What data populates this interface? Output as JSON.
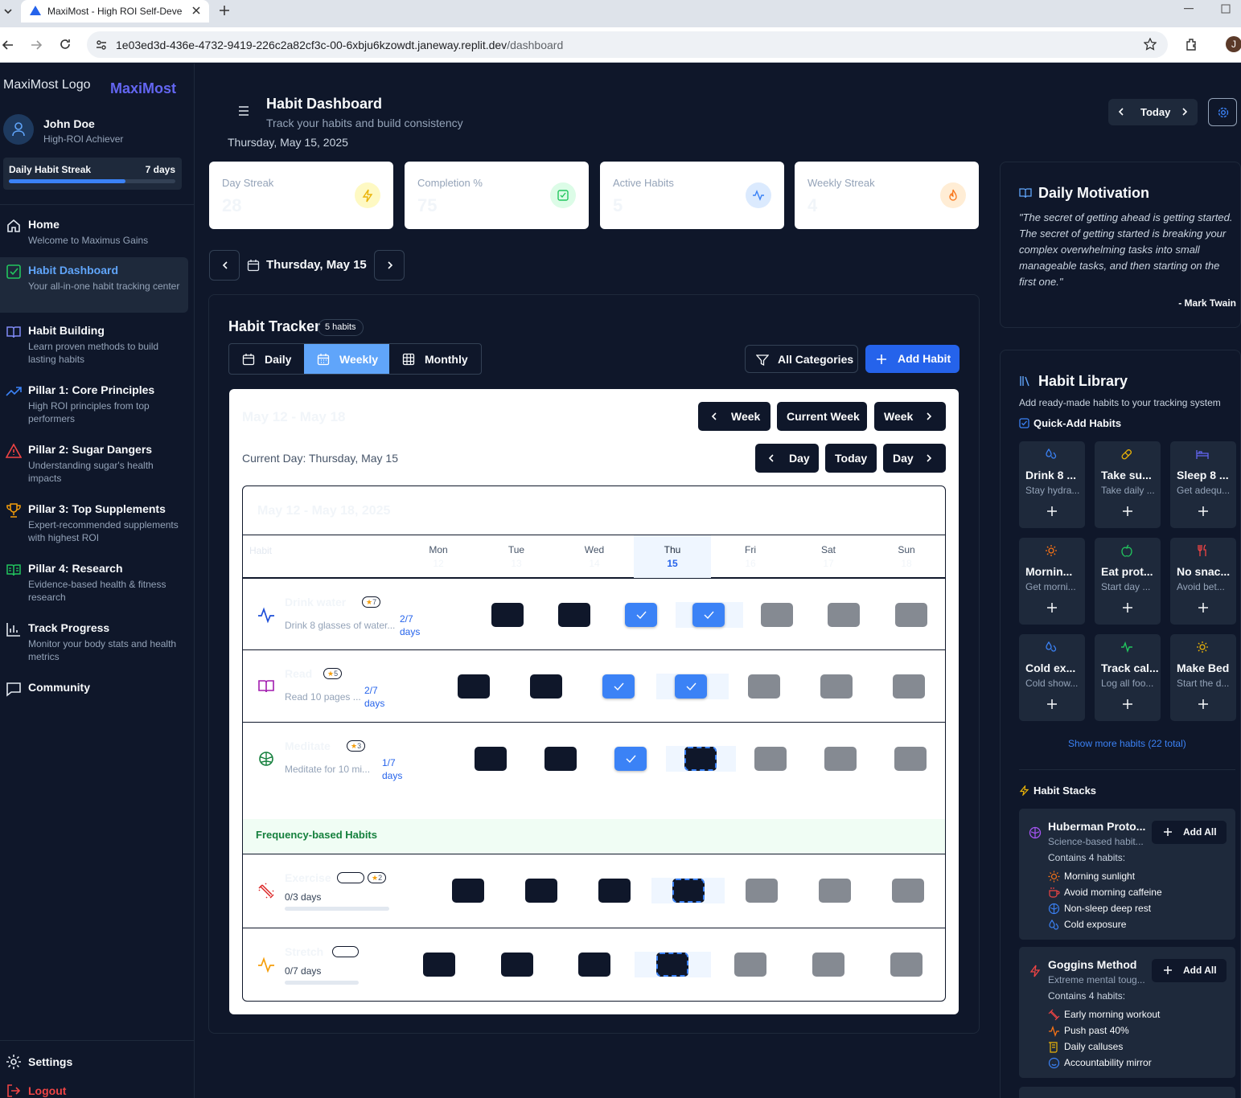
{
  "browser": {
    "tab_title": "MaxiMost - High ROI Self-Deve",
    "url_host": "1e03ed3d-436e-4732-9419-226c2a82cf3c-00-6xbju6kzowdt.janeway.replit.dev",
    "url_path": "/dashboard",
    "profile_initial": "J"
  },
  "sidebar": {
    "logo_alt": "MaxiMost Logo",
    "brand": "MaxiMost",
    "user_name": "John Doe",
    "user_role": "High-ROI Achiever",
    "streak_label": "Daily Habit Streak",
    "streak_value": "7 days",
    "streak_progress": 0.7,
    "items": [
      {
        "title": "Home",
        "desc": "Welcome to Maximus Gains"
      },
      {
        "title": "Habit Dashboard",
        "desc": "Your all-in-one habit tracking center"
      },
      {
        "title": "Habit Building",
        "desc": "Learn proven methods to build lasting habits"
      },
      {
        "title": "Pillar 1: Core Principles",
        "desc": "High ROI principles from top performers"
      },
      {
        "title": "Pillar 2: Sugar Dangers",
        "desc": "Understanding sugar's health impacts"
      },
      {
        "title": "Pillar 3: Top Supplements",
        "desc": "Expert-recommended supplements with highest ROI"
      },
      {
        "title": "Pillar 4: Research",
        "desc": "Evidence-based health & fitness research"
      },
      {
        "title": "Track Progress",
        "desc": "Monitor your body stats and health metrics"
      },
      {
        "title": "Community",
        "desc": ""
      }
    ],
    "settings": "Settings",
    "logout": "Logout"
  },
  "header": {
    "title": "Habit Dashboard",
    "subtitle": "Track your habits and build consistency",
    "date": "Thursday, May 15, 2025",
    "today_btn": "Today"
  },
  "stats": [
    {
      "label": "Day Streak",
      "value": "28",
      "color": "#eab308"
    },
    {
      "label": "Completion %",
      "value": "75",
      "color": "#22c55e"
    },
    {
      "label": "Active Habits",
      "value": "5",
      "color": "#3b82f6"
    },
    {
      "label": "Weekly Streak",
      "value": "4",
      "color": "#f97316"
    }
  ],
  "date_nav": {
    "label": "Thursday, May 15"
  },
  "tracker": {
    "title": "Habit Tracker",
    "count": "5 habits",
    "views": [
      "Daily",
      "Weekly",
      "Monthly"
    ],
    "categories_btn": "All Categories",
    "add_btn": "Add Habit",
    "week_range": "May 12 - May 18",
    "prev_week": "Week",
    "current_week": "Current Week",
    "next_week": "Week",
    "current_day": "Current Day: Thursday, May 15",
    "prev_day": "Day",
    "today": "Today",
    "next_day": "Day",
    "table_range": "May 12 - May 18, 2025",
    "habit_col": "Habit",
    "days": [
      {
        "name": "Mon",
        "date": "12"
      },
      {
        "name": "Tue",
        "date": "13"
      },
      {
        "name": "Wed",
        "date": "14"
      },
      {
        "name": "Thu",
        "date": "15"
      },
      {
        "name": "Fri",
        "date": "16"
      },
      {
        "name": "Sat",
        "date": "17"
      },
      {
        "name": "Sun",
        "date": "18"
      }
    ],
    "habits": [
      {
        "name": "Drink water",
        "desc": "Drink 8 glasses of water...",
        "points": "7",
        "progress": "2/7",
        "unit": "days",
        "icon": "activity-icon",
        "color": "#1d4ed8"
      },
      {
        "name": "Read",
        "desc": "Read 10 pages ...",
        "points": "5",
        "progress": "2/7",
        "unit": "days",
        "icon": "book-icon",
        "color": "#a21caf"
      },
      {
        "name": "Meditate",
        "desc": "Meditate for 10 mi...",
        "points": "3",
        "progress": "1/7",
        "unit": "days",
        "icon": "brain-icon",
        "color": "#15803d"
      }
    ],
    "freq_header": "Frequency-based Habits",
    "freq_habits": [
      {
        "name": "Exercise",
        "points": "2",
        "progress": "0/3 days",
        "icon": "dumbbell-icon",
        "color": "#dc2626"
      },
      {
        "name": "Stretch",
        "progress": "0/7 days",
        "icon": "activity-icon",
        "color": "#f59e0b"
      }
    ]
  },
  "motivation": {
    "title": "Daily Motivation",
    "quote": "\"The secret of getting ahead is getting started. The secret of getting started is breaking your complex overwhelming tasks into small manageable tasks, and then starting on the first one.\"",
    "author": "- Mark Twain"
  },
  "library": {
    "title": "Habit Library",
    "subtitle": "Add ready-made habits to your tracking system",
    "quick_add": "Quick-Add Habits",
    "items": [
      {
        "name": "Drink 8 ...",
        "desc": "Stay hydra...",
        "icon": "droplets-icon",
        "color": "#3b82f6"
      },
      {
        "name": "Take su...",
        "desc": "Take daily ...",
        "icon": "pill-icon",
        "color": "#eab308"
      },
      {
        "name": "Sleep 8 ...",
        "desc": "Get adequ...",
        "icon": "bed-icon",
        "color": "#6366f1"
      },
      {
        "name": "Mornin...",
        "desc": "Get morni...",
        "icon": "sun-icon",
        "color": "#f97316"
      },
      {
        "name": "Eat prot...",
        "desc": "Start day ...",
        "icon": "apple-icon",
        "color": "#22c55e"
      },
      {
        "name": "No snac...",
        "desc": "Avoid bet...",
        "icon": "utensils-icon",
        "color": "#ef4444"
      },
      {
        "name": "Cold ex...",
        "desc": "Cold show...",
        "icon": "droplets-icon",
        "color": "#3b82f6"
      },
      {
        "name": "Track cal...",
        "desc": "Log all foo...",
        "icon": "activity-icon",
        "color": "#22c55e"
      },
      {
        "name": "Make Bed",
        "desc": "Start the d...",
        "icon": "sun-icon",
        "color": "#eab308"
      }
    ],
    "show_more": "Show more habits (22 total)",
    "stacks_title": "Habit Stacks",
    "stacks": [
      {
        "name": "Huberman Proto...",
        "desc": "Science-based habit...",
        "count": "Contains 4 habits:",
        "add": "Add All",
        "color": "#a855f7",
        "items": [
          {
            "label": "Morning sunlight",
            "color": "#f97316"
          },
          {
            "label": "Avoid morning caffeine",
            "color": "#ef4444"
          },
          {
            "label": "Non-sleep deep rest",
            "color": "#3b82f6"
          },
          {
            "label": "Cold exposure",
            "color": "#3b82f6"
          }
        ]
      },
      {
        "name": "Goggins Method",
        "desc": "Extreme mental toug...",
        "count": "Contains 4 habits:",
        "add": "Add All",
        "color": "#ef4444",
        "items": [
          {
            "label": "Early morning workout",
            "color": "#ef4444"
          },
          {
            "label": "Push past 40%",
            "color": "#f97316"
          },
          {
            "label": "Daily calluses",
            "color": "#eab308"
          },
          {
            "label": "Accountability mirror",
            "color": "#3b82f6"
          }
        ]
      }
    ]
  }
}
